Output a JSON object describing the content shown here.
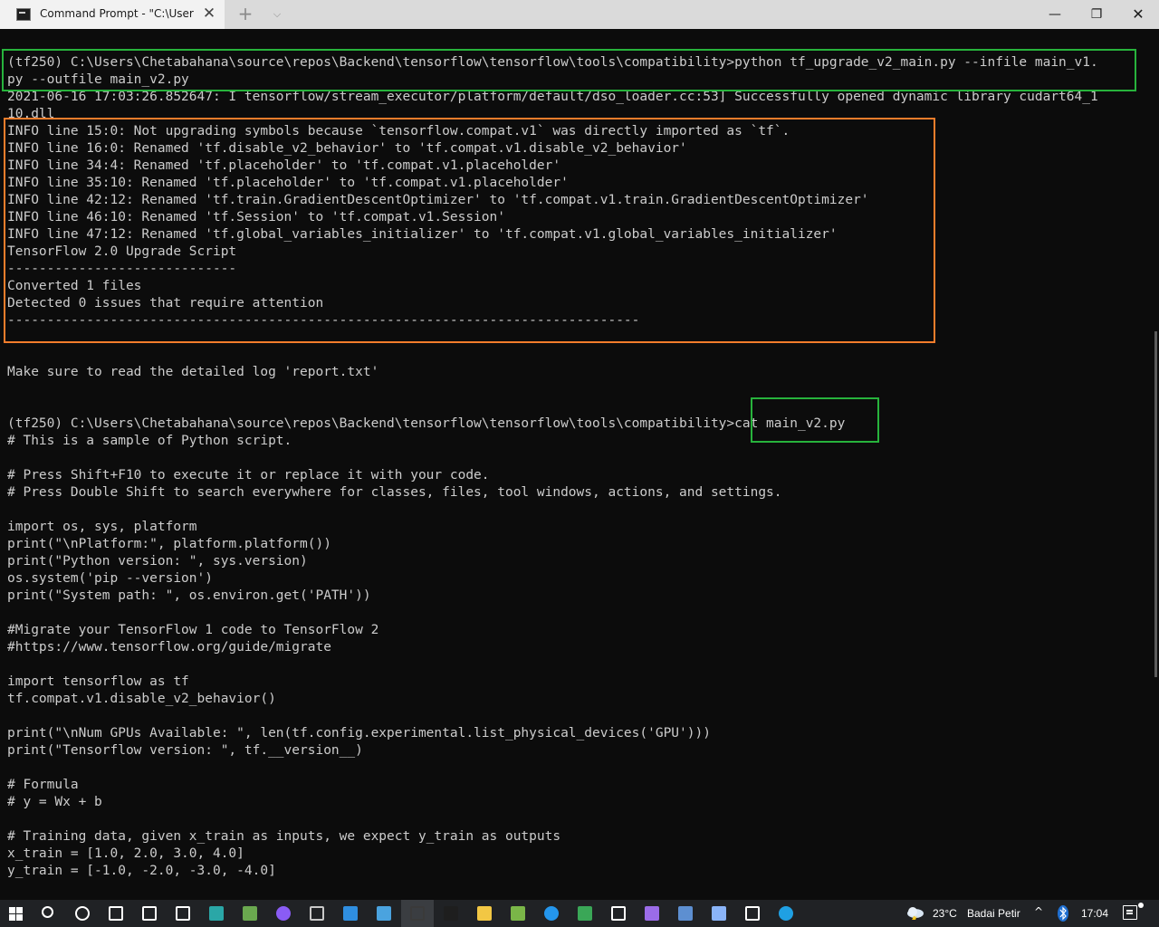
{
  "window": {
    "tab_title": "Command Prompt - \"C:\\Users\\C",
    "tab_close": "✕",
    "new_tab": "+",
    "dropdown": "⌵",
    "minimize": "—",
    "maximize": "❐",
    "close": "✕"
  },
  "terminal": {
    "lines": [
      "(tf250) C:\\Users\\Chetabahana\\source\\repos\\Backend\\tensorflow\\tensorflow\\tools\\compatibility>python tf_upgrade_v2_main.py --infile main_v1.",
      "py --outfile main_v2.py",
      "2021-06-16 17:03:26.852647: I tensorflow/stream_executor/platform/default/dso_loader.cc:53] Successfully opened dynamic library cudart64_1",
      "10.dll",
      "INFO line 15:0: Not upgrading symbols because `tensorflow.compat.v1` was directly imported as `tf`.",
      "INFO line 16:0: Renamed 'tf.disable_v2_behavior' to 'tf.compat.v1.disable_v2_behavior'",
      "INFO line 34:4: Renamed 'tf.placeholder' to 'tf.compat.v1.placeholder'",
      "INFO line 35:10: Renamed 'tf.placeholder' to 'tf.compat.v1.placeholder'",
      "INFO line 42:12: Renamed 'tf.train.GradientDescentOptimizer' to 'tf.compat.v1.train.GradientDescentOptimizer'",
      "INFO line 46:10: Renamed 'tf.Session' to 'tf.compat.v1.Session'",
      "INFO line 47:12: Renamed 'tf.global_variables_initializer' to 'tf.compat.v1.global_variables_initializer'",
      "TensorFlow 2.0 Upgrade Script",
      "-----------------------------",
      "Converted 1 files",
      "Detected 0 issues that require attention",
      "--------------------------------------------------------------------------------",
      "",
      "",
      "Make sure to read the detailed log 'report.txt'",
      "",
      "",
      "(tf250) C:\\Users\\Chetabahana\\source\\repos\\Backend\\tensorflow\\tensorflow\\tools\\compatibility>cat main_v2.py",
      "# This is a sample of Python script.",
      "",
      "# Press Shift+F10 to execute it or replace it with your code.",
      "# Press Double Shift to search everywhere for classes, files, tool windows, actions, and settings.",
      "",
      "import os, sys, platform",
      "print(\"\\nPlatform:\", platform.platform())",
      "print(\"Python version: \", sys.version)",
      "os.system('pip --version')",
      "print(\"System path: \", os.environ.get('PATH'))",
      "",
      "#Migrate your TensorFlow 1 code to TensorFlow 2",
      "#https://www.tensorflow.org/guide/migrate",
      "",
      "import tensorflow as tf",
      "tf.compat.v1.disable_v2_behavior()",
      "",
      "print(\"\\nNum GPUs Available: \", len(tf.config.experimental.list_physical_devices('GPU')))",
      "print(\"Tensorflow version: \", tf.__version__)",
      "",
      "# Formula",
      "# y = Wx + b",
      "",
      "# Training data, given x_train as inputs, we expect y_train as outputs",
      "x_train = [1.0, 2.0, 3.0, 4.0]",
      "y_train = [-1.0, -2.0, -3.0, -4.0]"
    ]
  },
  "colors": {
    "terminal_bg": "#0c0c0c",
    "terminal_text": "#cccccc",
    "highlight_green": "#27b33c",
    "highlight_orange": "#f37d2b",
    "taskbar_bg": "#202225"
  },
  "taskbar": {
    "icons": [
      {
        "name": "search-icon",
        "color": "#ffffff"
      },
      {
        "name": "cortana-icon",
        "color": "#ffffff"
      },
      {
        "name": "task-view-icon",
        "color": "#ffffff"
      },
      {
        "name": "settings-icon",
        "color": "#ffffff"
      },
      {
        "name": "windows-security-icon",
        "color": "#ffffff"
      },
      {
        "name": "app-tile-icon",
        "color": "#2aa7a7"
      },
      {
        "name": "git-icon",
        "color": "#6aa84f"
      },
      {
        "name": "github-desktop-icon",
        "color": "#8a5cf5"
      },
      {
        "name": "anaconda-icon",
        "color": "#c9c9c9"
      },
      {
        "name": "mail-icon",
        "color": "#2f8ee0"
      },
      {
        "name": "remote-desktop-icon",
        "color": "#4aa3df"
      },
      {
        "name": "windows-terminal-icon",
        "color": "#3a3a3a"
      },
      {
        "name": "command-prompt-icon",
        "color": "#1e1e1e"
      },
      {
        "name": "file-explorer-icon",
        "color": "#f2c744"
      },
      {
        "name": "sourcetree-icon",
        "color": "#7ab648"
      },
      {
        "name": "docker-icon",
        "color": "#2496ed"
      },
      {
        "name": "notebook-icon",
        "color": "#3aa757"
      },
      {
        "name": "store-icon",
        "color": "#ffffff"
      },
      {
        "name": "visual-studio-icon",
        "color": "#9b6ce8"
      },
      {
        "name": "diagram-tool-icon",
        "color": "#5d8fd1"
      },
      {
        "name": "notepad-icon",
        "color": "#8ab4f8"
      },
      {
        "name": "pycharm-icon",
        "color": "#ffffff"
      },
      {
        "name": "edge-icon",
        "color": "#1fa0e3"
      }
    ],
    "tray": {
      "temperature": "23°C",
      "weather": "Badai Petir",
      "chevron": "^",
      "time": "17:04"
    }
  }
}
